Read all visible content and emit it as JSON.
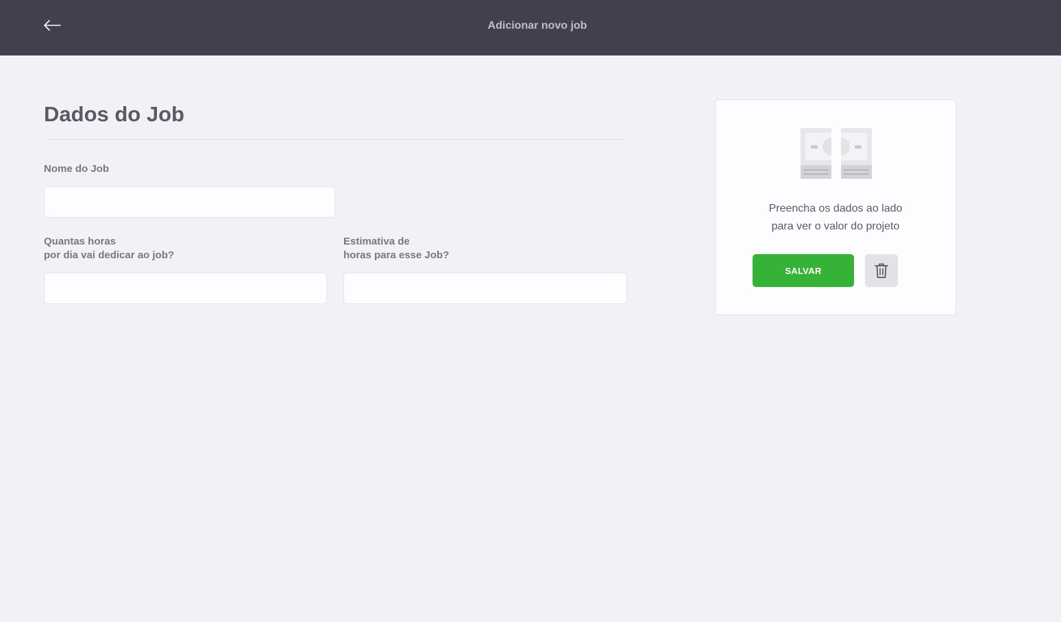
{
  "header": {
    "title": "Adicionar novo job",
    "back_icon": "arrow-left-icon",
    "background": "#41414D"
  },
  "form": {
    "section_title": "Dados do Job",
    "fields": [
      {
        "label_lines": [
          "Nome do Job"
        ],
        "value": "",
        "placeholder": ""
      },
      {
        "label_lines": [
          "Quantas horas",
          "por dia vai dedicar ao job?"
        ],
        "value": "",
        "placeholder": ""
      },
      {
        "label_lines": [
          "Estimativa de",
          "horas para esse Job?"
        ],
        "value": "",
        "placeholder": ""
      }
    ]
  },
  "summary_card": {
    "icon": "money-icon",
    "message_lines": [
      "Preencha os dados ao lado",
      "para ver o valor do projeto"
    ],
    "save_label": "SALVAR",
    "delete_icon": "trash-icon",
    "accent_color": "#36B336"
  }
}
